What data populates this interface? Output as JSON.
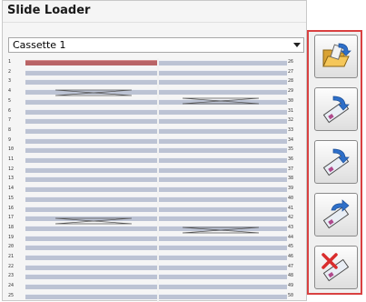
{
  "window": {
    "title": "Slide Loader"
  },
  "cassette_select": {
    "value": "Cassette 1"
  },
  "slots": {
    "left_numbers": [
      "1",
      "2",
      "3",
      "4",
      "5",
      "6",
      "7",
      "8",
      "9",
      "10",
      "11",
      "12",
      "13",
      "14",
      "15",
      "16",
      "17",
      "18",
      "19",
      "20",
      "21",
      "22",
      "23",
      "24",
      "25"
    ],
    "right_numbers": [
      "26",
      "27",
      "28",
      "29",
      "30",
      "31",
      "32",
      "33",
      "34",
      "35",
      "36",
      "37",
      "38",
      "39",
      "40",
      "41",
      "42",
      "43",
      "44",
      "45",
      "46",
      "47",
      "48",
      "49",
      "50"
    ],
    "selected_slot": "1"
  },
  "toolbar": {
    "buttons": [
      {
        "name": "open-folder-button",
        "icon": "open-folder-icon"
      },
      {
        "name": "load-slide-button",
        "icon": "load-slide-icon"
      },
      {
        "name": "load-slide-alt-button",
        "icon": "load-slide-alt-icon"
      },
      {
        "name": "unload-slide-button",
        "icon": "unload-slide-icon"
      },
      {
        "name": "remove-slide-button",
        "icon": "remove-slide-icon"
      }
    ]
  },
  "colors": {
    "slot_fill": "#bcc3d4",
    "selected_slot": "#b96466",
    "toolbar_border": "#d94141"
  }
}
